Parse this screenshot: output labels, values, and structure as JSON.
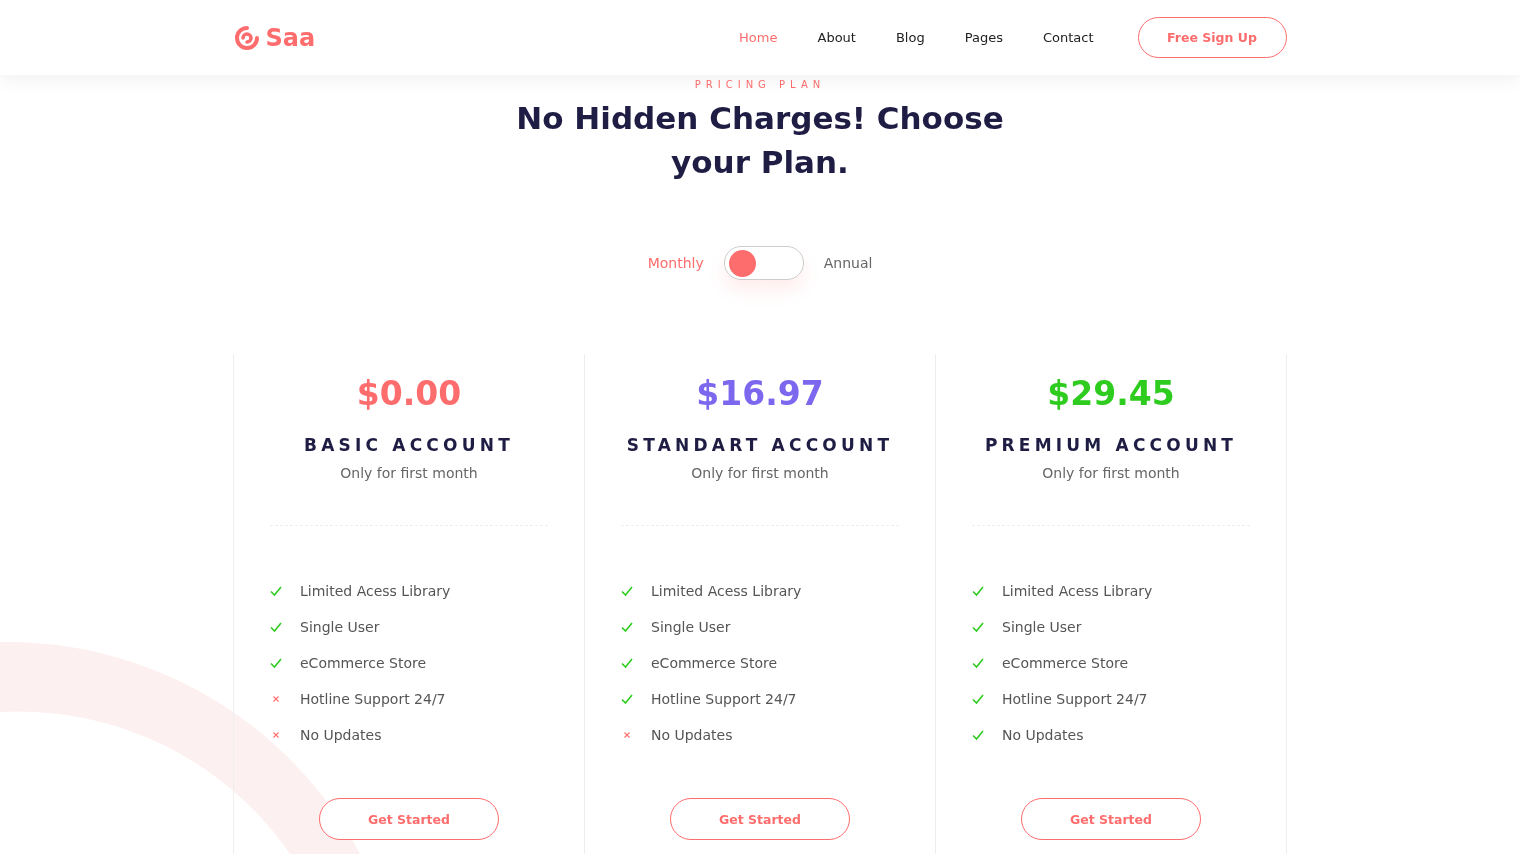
{
  "header": {
    "logo": "Saa",
    "nav": [
      {
        "label": "Home",
        "selected": true
      },
      {
        "label": "About",
        "selected": false
      },
      {
        "label": "Blog",
        "selected": false
      },
      {
        "label": "Pages",
        "selected": false
      },
      {
        "label": "Contact",
        "selected": false
      }
    ],
    "signup_button": "Free Sign Up"
  },
  "section": {
    "eyebrow": "PRICING PLAN",
    "title": "No Hidden Charges! Choose your Plan."
  },
  "billing": {
    "options": [
      {
        "label": "Monthly",
        "selected": true
      },
      {
        "label": "Annual",
        "selected": false
      }
    ],
    "on": false
  },
  "plans": [
    {
      "price": "$0.00",
      "color": "#fe6d6d",
      "name": "BASIC ACCOUNT",
      "note": "Only for first month",
      "features": [
        {
          "label": "Limited Acess Library",
          "included": true
        },
        {
          "label": "Single User",
          "included": true
        },
        {
          "label": "eCommerce Store",
          "included": true
        },
        {
          "label": "Hotline Support 24/7",
          "included": false
        },
        {
          "label": "No Updates",
          "included": false
        }
      ],
      "button": "Get Started"
    },
    {
      "price": "$16.97",
      "color": "#7b68ee",
      "name": "STANDART ACCOUNT",
      "note": "Only for first month",
      "features": [
        {
          "label": "Limited Acess Library",
          "included": true
        },
        {
          "label": "Single User",
          "included": true
        },
        {
          "label": "eCommerce Store",
          "included": true
        },
        {
          "label": "Hotline Support 24/7",
          "included": true
        },
        {
          "label": "No Updates",
          "included": false
        }
      ],
      "button": "Get Started"
    },
    {
      "price": "$29.45",
      "color": "#2ecc1f",
      "name": "PREMIUM ACCOUNT",
      "note": "Only for first month",
      "features": [
        {
          "label": "Limited Acess Library",
          "included": true
        },
        {
          "label": "Single User",
          "included": true
        },
        {
          "label": "eCommerce Store",
          "included": true
        },
        {
          "label": "Hotline Support 24/7",
          "included": true
        },
        {
          "label": "No Updates",
          "included": true
        }
      ],
      "button": "Get Started"
    }
  ]
}
